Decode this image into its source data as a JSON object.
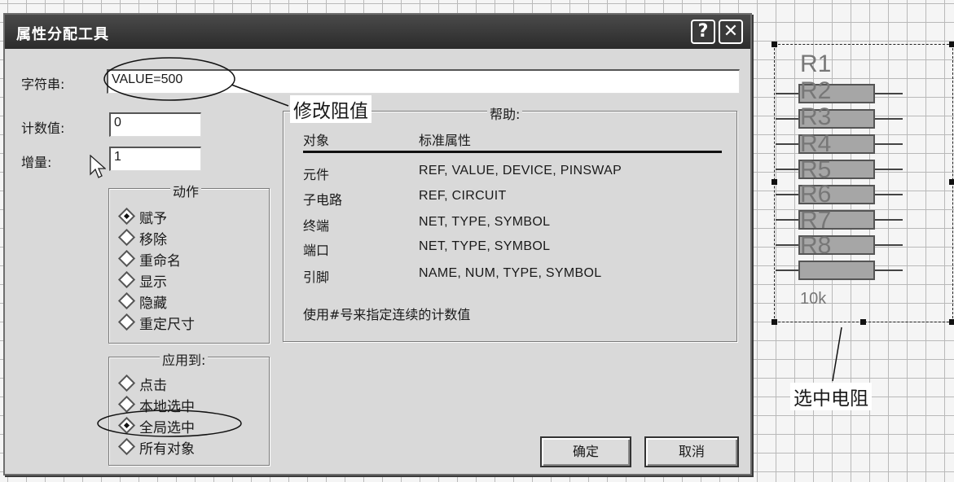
{
  "dialog": {
    "title": "属性分配工具",
    "help_icon": "?",
    "close_icon": "✕",
    "string_label": "字符串:",
    "string_value": "VALUE=500",
    "count_label": "计数值:",
    "count_value": "0",
    "increment_label": "增量:",
    "increment_value": "1",
    "action": {
      "title": "动作",
      "options": [
        "赋予",
        "移除",
        "重命名",
        "显示",
        "隐藏",
        "重定尺寸"
      ],
      "selected": "赋予"
    },
    "apply_to": {
      "title": "应用到:",
      "options": [
        "点击",
        "本地选中",
        "全局选中",
        "所有对象"
      ],
      "selected": "全局选中"
    },
    "help": {
      "title": "帮助:",
      "col_object": "对象",
      "col_attrs": "标准属性",
      "rows": [
        {
          "object": "元件",
          "attrs": "REF, VALUE, DEVICE, PINSWAP"
        },
        {
          "object": "子电路",
          "attrs": "REF, CIRCUIT"
        },
        {
          "object": "终端",
          "attrs": "NET, TYPE, SYMBOL"
        },
        {
          "object": "端口",
          "attrs": "NET, TYPE, SYMBOL"
        },
        {
          "object": "引脚",
          "attrs": "NAME, NUM, TYPE, SYMBOL"
        }
      ],
      "note": "使用#号来指定连续的计数值"
    },
    "ok_label": "确定",
    "cancel_label": "取消"
  },
  "annotations": {
    "modify_value": "修改阻值",
    "selected_resistors": "选中电阻"
  },
  "schematic": {
    "labels": [
      "R1",
      "R2",
      "R3",
      "R4",
      "R5",
      "R6",
      "R7",
      "R8"
    ],
    "value_label": "10k"
  }
}
